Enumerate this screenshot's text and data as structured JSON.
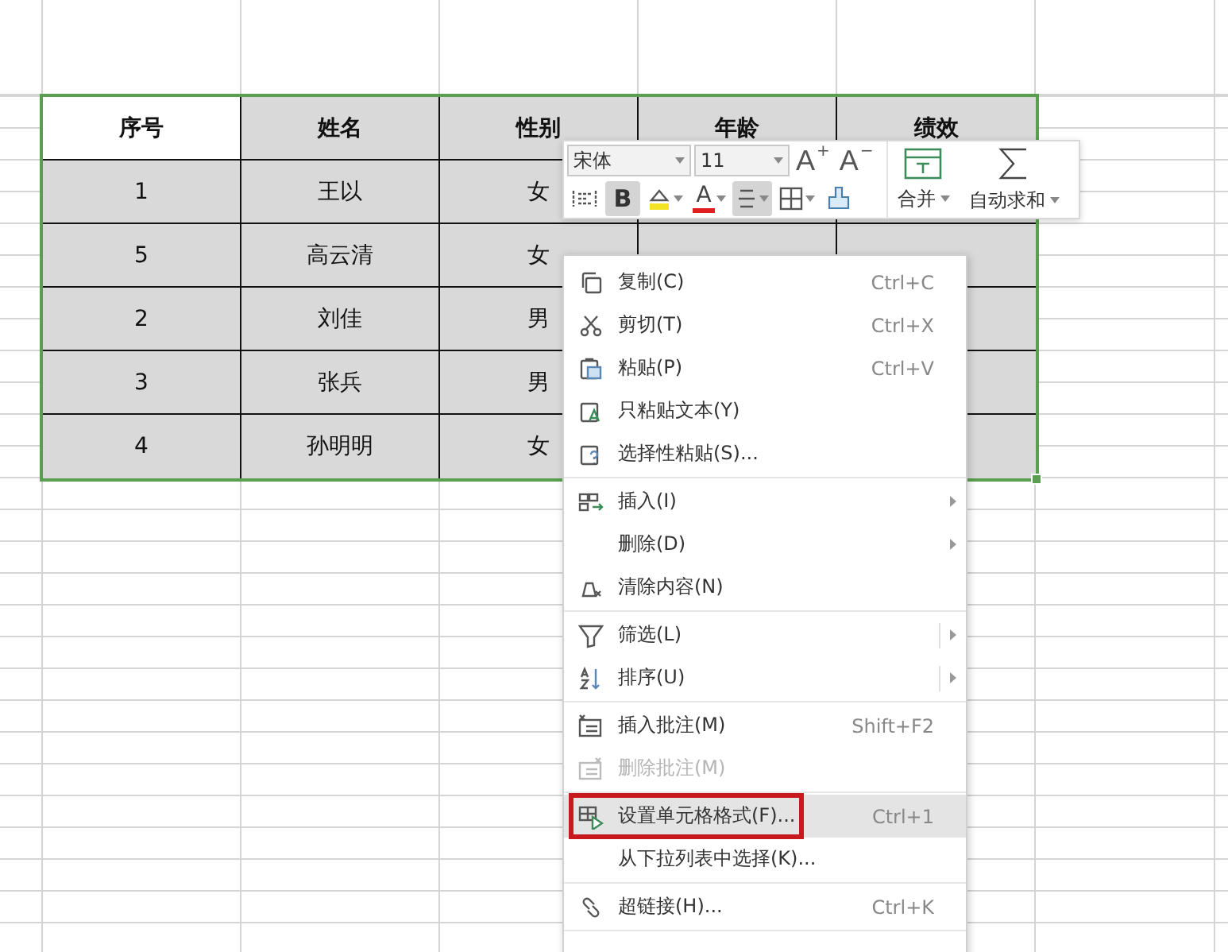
{
  "table": {
    "header": [
      {
        "text": "序号",
        "selected": true
      },
      {
        "text": "姓名",
        "selected": false
      },
      {
        "text": "性别",
        "selected": false
      },
      {
        "text": "年龄",
        "selected": false
      },
      {
        "text": "绩效",
        "selected": false
      }
    ],
    "rows": [
      [
        "1",
        "王以",
        "女"
      ],
      [
        "5",
        "高云清",
        "女"
      ],
      [
        "2",
        "刘佳",
        "男"
      ],
      [
        "3",
        "张兵",
        "男"
      ],
      [
        "4",
        "孙明明",
        "女"
      ]
    ]
  },
  "toolbar": {
    "font": "宋体",
    "size": "11",
    "grow": {
      "label": "A",
      "sign": "+"
    },
    "shrink": {
      "label": "A",
      "sign": "−"
    },
    "merge": "合并",
    "autosum": "自动求和",
    "bold": {
      "label": "B",
      "selected": true
    },
    "font_color": {
      "label": "A"
    },
    "align_center": {
      "selected": true
    }
  },
  "menu": {
    "groups": [
      {
        "items": [
          {
            "label": "复制(C)",
            "shortcut": "Ctrl+C",
            "submenu": false,
            "disabled": false,
            "highlighted": false
          },
          {
            "label": "剪切(T)",
            "shortcut": "Ctrl+X",
            "submenu": false,
            "disabled": false,
            "highlighted": false
          },
          {
            "label": "粘贴(P)",
            "shortcut": "Ctrl+V",
            "submenu": false,
            "disabled": false,
            "highlighted": false
          },
          {
            "label": "只粘贴文本(Y)",
            "submenu": false,
            "disabled": false,
            "highlighted": false
          },
          {
            "label": "选择性粘贴(S)...",
            "submenu": false,
            "disabled": false,
            "highlighted": false
          }
        ]
      },
      {
        "items": [
          {
            "label": "插入(I)",
            "submenu": true,
            "disabled": false,
            "highlighted": false
          },
          {
            "label": "删除(D)",
            "submenu": true,
            "disabled": false,
            "highlighted": false
          },
          {
            "label": "清除内容(N)",
            "submenu": false,
            "disabled": false,
            "highlighted": false
          }
        ]
      },
      {
        "items": [
          {
            "label": "筛选(L)",
            "submenu": true,
            "disabled": false,
            "highlighted": false
          },
          {
            "label": "排序(U)",
            "submenu": true,
            "disabled": false,
            "highlighted": false
          }
        ]
      },
      {
        "items": [
          {
            "label": "插入批注(M)",
            "shortcut": "Shift+F2",
            "submenu": false,
            "disabled": false,
            "highlighted": false
          },
          {
            "label": "删除批注(M)",
            "submenu": false,
            "disabled": true,
            "highlighted": false
          }
        ]
      },
      {
        "items": [
          {
            "label": "设置单元格格式(F)...",
            "shortcut": "Ctrl+1",
            "submenu": false,
            "disabled": false,
            "highlighted": true
          },
          {
            "label": "从下拉列表中选择(K)...",
            "submenu": false,
            "disabled": false,
            "highlighted": false
          }
        ]
      },
      {
        "items": [
          {
            "label": "超链接(H)...",
            "shortcut": "Ctrl+K",
            "submenu": false,
            "disabled": false,
            "highlighted": false
          }
        ]
      }
    ]
  }
}
